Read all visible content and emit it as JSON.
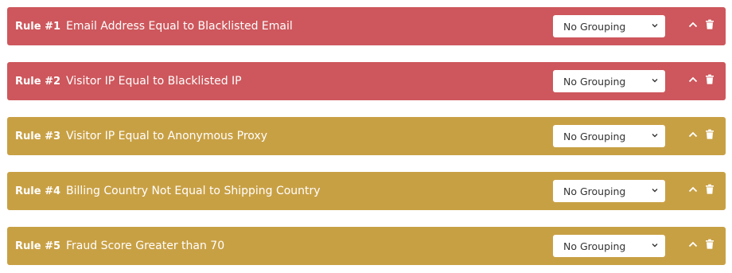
{
  "rules": [
    {
      "number": "Rule #1",
      "description": "Email Address Equal to Blacklisted Email",
      "grouping": "No Grouping",
      "color": "#cd575c"
    },
    {
      "number": "Rule #2",
      "description": "Visitor IP Equal to Blacklisted IP",
      "grouping": "No Grouping",
      "color": "#cd575c"
    },
    {
      "number": "Rule #3",
      "description": "Visitor IP Equal to Anonymous Proxy",
      "grouping": "No Grouping",
      "color": "#c8a044"
    },
    {
      "number": "Rule #4",
      "description": "Billing Country Not Equal to Shipping Country",
      "grouping": "No Grouping",
      "color": "#c8a044"
    },
    {
      "number": "Rule #5",
      "description": "Fraud Score Greater than 70",
      "grouping": "No Grouping",
      "color": "#c8a044"
    }
  ],
  "icons": {
    "collapse": "chevron-up-icon",
    "delete": "trash-icon",
    "select_arrow": "chevron-down-icon"
  }
}
